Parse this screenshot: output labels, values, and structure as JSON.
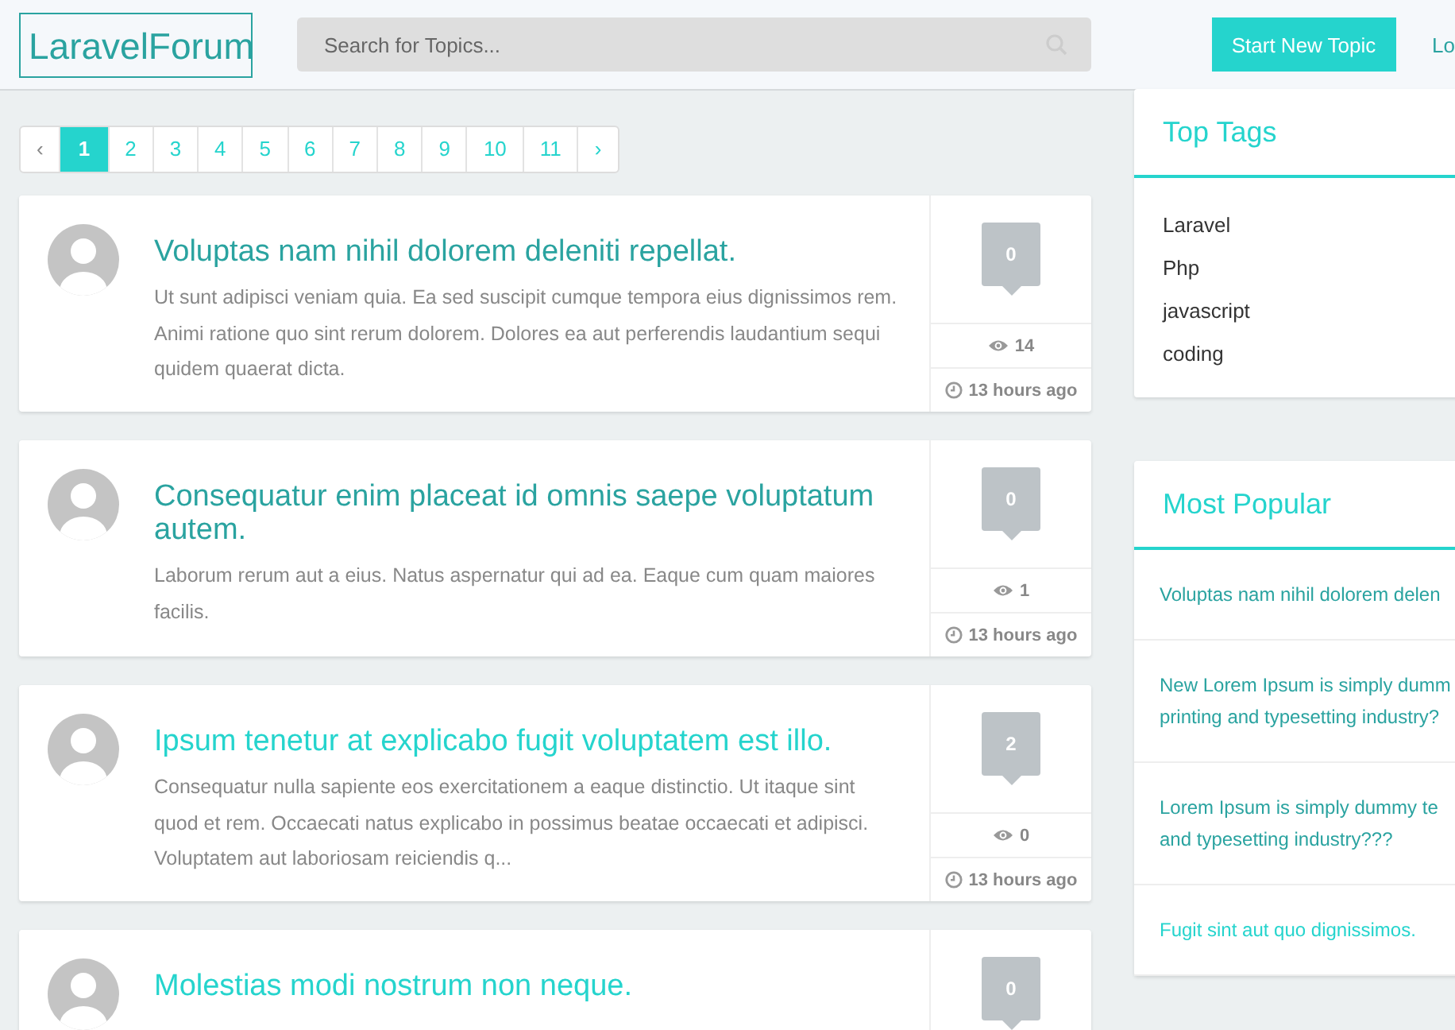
{
  "header": {
    "logo": "LaravelForum",
    "search": {
      "placeholder": "Search for Topics..."
    },
    "new_topic_button": "Start New Topic",
    "login_link": "Lo"
  },
  "pagination": {
    "prev": "‹",
    "next": "›",
    "pages": [
      {
        "label": "1",
        "selected": true
      },
      {
        "label": "2",
        "selected": false
      },
      {
        "label": "3",
        "selected": false
      },
      {
        "label": "4",
        "selected": false
      },
      {
        "label": "5",
        "selected": false
      },
      {
        "label": "6",
        "selected": false
      },
      {
        "label": "7",
        "selected": false
      },
      {
        "label": "8",
        "selected": false
      },
      {
        "label": "9",
        "selected": false
      },
      {
        "label": "10",
        "selected": false
      },
      {
        "label": "11",
        "selected": false
      }
    ]
  },
  "topics": [
    {
      "title": "Voluptas nam nihil dolorem deleniti repellat.",
      "visited": true,
      "excerpt": "Ut sunt adipisci veniam quia. Ea sed suscipit cumque tempora eius dignissimos rem. Animi ratione quo sint rerum dolorem. Dolores ea aut perferendis laudantium sequi quidem quaerat dicta.",
      "replies": "0",
      "views": "14",
      "time": "13 hours ago"
    },
    {
      "title": "Consequatur enim placeat id omnis saepe voluptatum autem.",
      "visited": true,
      "excerpt": "Laborum rerum aut a eius. Natus aspernatur qui ad ea. Eaque cum quam maiores facilis.",
      "replies": "0",
      "views": "1",
      "time": "13 hours ago"
    },
    {
      "title": "Ipsum tenetur at explicabo fugit voluptatem est illo.",
      "visited": false,
      "excerpt": "Consequatur nulla sapiente eos exercitationem a eaque distinctio. Ut itaque sint quod et rem. Occaecati natus explicabo in possimus beatae occaecati et adipisci. Voluptatem aut laboriosam reiciendis q...",
      "replies": "2",
      "views": "0",
      "time": "13 hours ago"
    },
    {
      "title": "Molestias modi nostrum non neque.",
      "visited": false,
      "replies": "0"
    }
  ],
  "sidebar": {
    "top_tags": {
      "title": "Top Tags",
      "tags": [
        "Laravel",
        "Php",
        "javascript",
        "coding"
      ]
    },
    "most_popular": {
      "title": "Most Popular",
      "items": [
        {
          "lines": [
            "Voluptas nam nihil dolorem delen"
          ],
          "visited": true
        },
        {
          "lines": [
            "New Lorem Ipsum is simply dumm",
            "printing and typesetting industry?"
          ],
          "visited": true
        },
        {
          "lines": [
            "Lorem Ipsum is simply dummy te",
            "and typesetting industry???"
          ],
          "visited": true
        },
        {
          "lines": [
            "Fugit sint aut quo dignissimos."
          ],
          "visited": false
        }
      ]
    }
  }
}
